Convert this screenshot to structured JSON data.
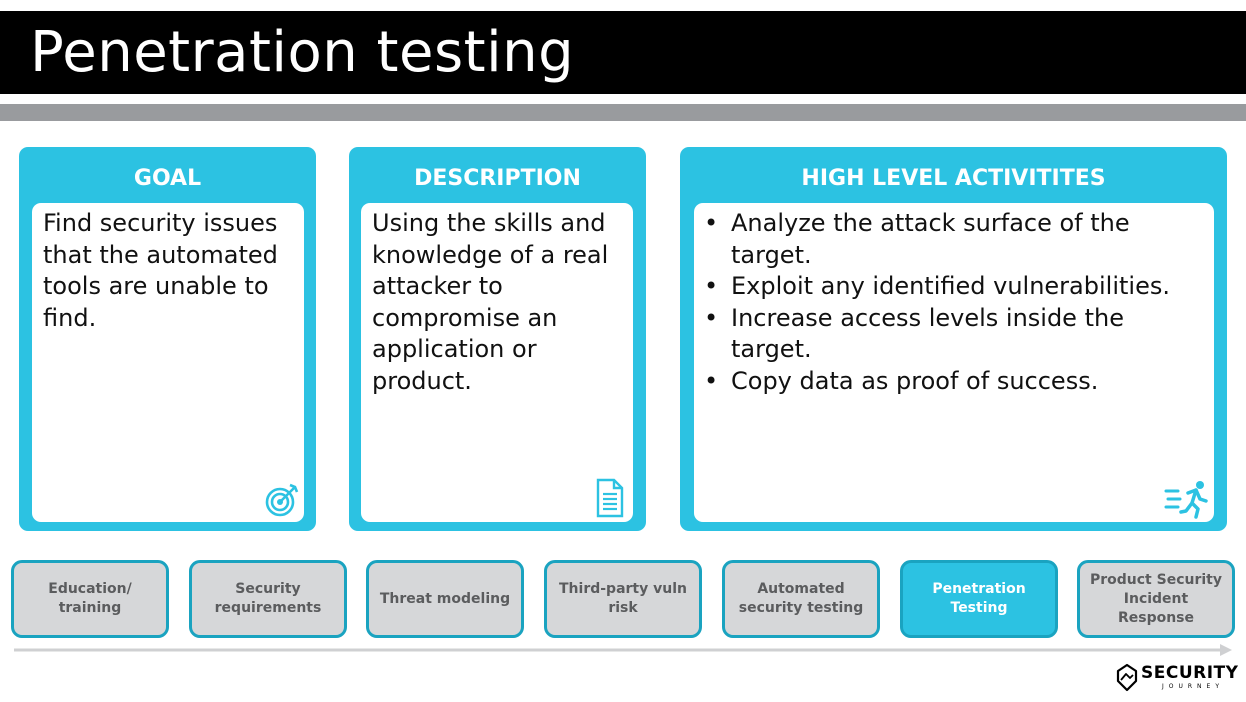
{
  "title": "Penetration testing",
  "colors": {
    "accent": "#2cc2e2",
    "step_border": "#1aa3c0",
    "step_inactive_bg": "#d6d7d9",
    "title_bar": "#000000",
    "rule": "#999b9e"
  },
  "cards": {
    "goal": {
      "heading": "GOAL",
      "text": "Find security issues that the automated tools are unable to find.",
      "icon": "target-icon"
    },
    "description": {
      "heading": "DESCRIPTION",
      "text": "Using the skills and knowledge of a real attacker to compromise an application or product.",
      "icon": "document-icon"
    },
    "activities": {
      "heading": "HIGH LEVEL ACTIVITITES",
      "items": [
        "Analyze the attack surface of the target.",
        "Exploit any identified vulnerabilities.",
        "Increase access levels inside the target.",
        "Copy data as proof of success."
      ],
      "icon": "running-person-icon"
    }
  },
  "steps": [
    {
      "label": "Education/\ntraining",
      "active": false
    },
    {
      "label": "Security\nrequirements",
      "active": false
    },
    {
      "label": "Threat modeling",
      "active": false
    },
    {
      "label": "Third-party vuln\nrisk",
      "active": false
    },
    {
      "label": "Automated\nsecurity testing",
      "active": false
    },
    {
      "label": "Penetration\nTesting",
      "active": true
    },
    {
      "label": "Product Security\nIncident\nResponse",
      "active": false
    }
  ],
  "logo": {
    "word": "SECURITY",
    "sub": "JOURNEY",
    "icon": "shield-logo-icon"
  }
}
